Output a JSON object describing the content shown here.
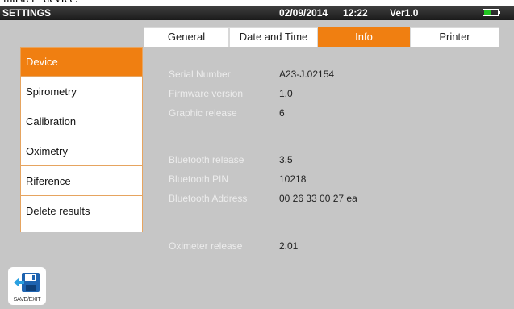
{
  "caption_text": "master\" device.",
  "status_bar": {
    "title": "SETTINGS",
    "date": "02/09/2014",
    "time": "12:22",
    "version": "Ver1.0",
    "battery_level": 0.5,
    "battery_color": "#21c421"
  },
  "tabs": [
    {
      "label": "General",
      "active": false
    },
    {
      "label": "Date and Time",
      "active": false
    },
    {
      "label": "Info",
      "active": true
    },
    {
      "label": "Printer",
      "active": false
    }
  ],
  "side_menu": [
    {
      "label": "Device",
      "active": true
    },
    {
      "label": "Spirometry",
      "active": false
    },
    {
      "label": "Calibration",
      "active": false
    },
    {
      "label": "Oximetry",
      "active": false
    },
    {
      "label": "Riference",
      "active": false
    },
    {
      "label": "Delete results",
      "active": false
    }
  ],
  "info": {
    "serial_number": {
      "label": "Serial Number",
      "value": "A23-J.02154"
    },
    "firmware_version": {
      "label": "Firmware version",
      "value": "1.0"
    },
    "graphic_release": {
      "label": "Graphic release",
      "value": "6"
    },
    "bluetooth_release": {
      "label": "Bluetooth release",
      "value": "3.5"
    },
    "bluetooth_pin": {
      "label": "Bluetooth PIN",
      "value": "10218"
    },
    "bluetooth_address": {
      "label": "Bluetooth Address",
      "value": "00 26 33 00 27 ea"
    },
    "oximeter_release": {
      "label": "Oximeter release",
      "value": "2.01"
    }
  },
  "save_button": {
    "label": "SAVE/EXIT",
    "icon": "save-exit-icon"
  },
  "colors": {
    "accent": "#f07f11",
    "background": "#c6c6c6"
  }
}
